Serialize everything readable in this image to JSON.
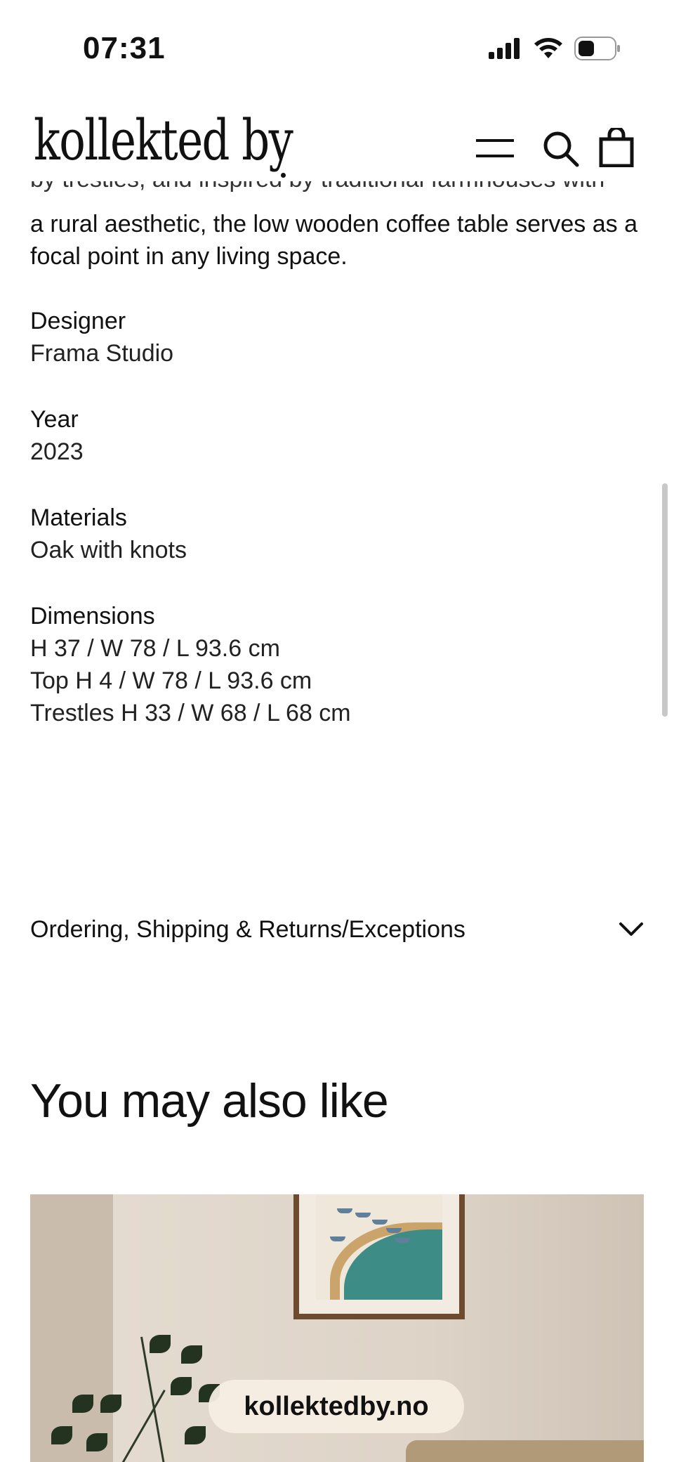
{
  "status_bar": {
    "time": "07:31",
    "icons": [
      "cellular-signal-icon",
      "wifi-icon",
      "battery-icon"
    ]
  },
  "header": {
    "logo": "kollekted by",
    "icons": [
      "menu-icon",
      "search-icon",
      "shopping-bag-icon"
    ]
  },
  "description": {
    "clipped_text": "by trestles, and inspired by traditional farmhouses with",
    "text": "a rural aesthetic, the low wooden coffee table serves as a focal point in any living space."
  },
  "specs": {
    "designer": {
      "label": "Designer",
      "value": "Frama Studio"
    },
    "year": {
      "label": "Year",
      "value": "2023"
    },
    "materials": {
      "label": "Materials",
      "value": "Oak with knots"
    },
    "dimensions": {
      "label": "Dimensions",
      "lines": [
        "H 37 / W 78 / L 93.6 cm",
        "Top H 4 / W 78 / L 93.6 cm",
        "Trestles H 33 / W 68 / L 68 cm"
      ]
    }
  },
  "accordion": {
    "label": "Ordering, Shipping & Returns/Exceptions",
    "icon": "chevron-down-icon"
  },
  "recommendations": {
    "title": "You may also like"
  },
  "watermark": "kollektedby.no",
  "colors": {
    "text": "#111111",
    "background": "#ffffff",
    "image_wall": "#ddd2c4",
    "frame_wood": "#6e4a2e"
  }
}
